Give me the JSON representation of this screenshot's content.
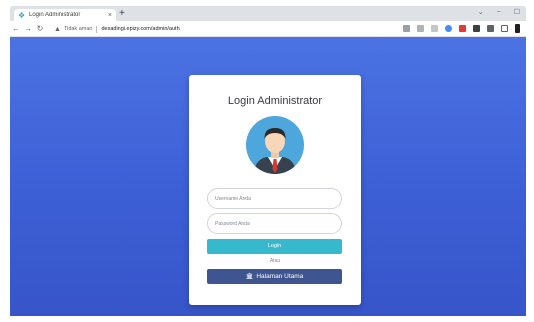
{
  "browser": {
    "tab_title": "Login Administrator",
    "tab_close": "×",
    "new_tab": "+",
    "not_secure_label": "Tidak aman",
    "url": "desadingi.epizy.com/admin/auth",
    "window_controls": [
      "⌄",
      "−",
      "☐"
    ]
  },
  "login": {
    "title": "Login Administrator",
    "username_placeholder": "Username Anda",
    "password_placeholder": "Password Anda",
    "login_button": "Login",
    "or_text": "Atau",
    "home_button": "Halaman Utama"
  },
  "colors": {
    "background_top": "#4b73e3",
    "background_bottom": "#3755c9",
    "login_button": "#36b9cc",
    "home_button": "#3f558f"
  },
  "icons": {
    "avatar": "businessman-avatar",
    "home_button_icon": "bank-icon"
  }
}
